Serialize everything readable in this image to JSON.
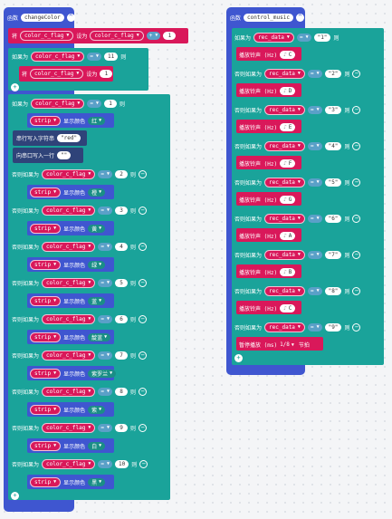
{
  "left_fn": {
    "head": "函数",
    "name": "changeColor"
  },
  "set_row": {
    "word": "将",
    "var": "color_c_flag",
    "mid": "设为",
    "var2": "color_c_flag",
    "op": "+",
    "num": "1"
  },
  "if1": {
    "kw": "如果为",
    "var": "color_c_flag",
    "eq": "=",
    "num": "11",
    "then": "则"
  },
  "set_in_if1": {
    "word": "将",
    "var": "color_c_flag",
    "mid": "设为",
    "num": "1"
  },
  "if2": {
    "kw": "如果为",
    "var": "color_c_flag",
    "eq": "=",
    "num": "1",
    "then": "则"
  },
  "strip_label": "strip",
  "show_color": "显示颜色",
  "c1": "红",
  "serial1": {
    "text": "串行写入字符串",
    "val": "\"red\""
  },
  "serial2": {
    "text": "向串口写入一行",
    "val": "\"\""
  },
  "else_if_label": "否则如果为",
  "branches": [
    {
      "num": "2",
      "color": "橙"
    },
    {
      "num": "3",
      "color": "黄"
    },
    {
      "num": "4",
      "color": "绿"
    },
    {
      "num": "5",
      "color": "蓝"
    },
    {
      "num": "6",
      "color": "靛蓝"
    },
    {
      "num": "7",
      "color": "紫罗兰"
    },
    {
      "num": "8",
      "color": "紫"
    },
    {
      "num": "9",
      "color": "白"
    },
    {
      "num": "10",
      "color": "黑"
    }
  ],
  "right_fn": {
    "head": "函数",
    "name": "control_music"
  },
  "music_var": "rec_data",
  "then": "则",
  "eq": "=",
  "play": "播放铃声 (Hz)",
  "music_first_kw": "如果为",
  "notes": [
    {
      "val": "\"1\"",
      "note": "C"
    },
    {
      "val": "\"2\"",
      "note": "D"
    },
    {
      "val": "\"3\"",
      "note": "E"
    },
    {
      "val": "\"4\"",
      "note": "F"
    },
    {
      "val": "\"5\"",
      "note": "G"
    },
    {
      "val": "\"6\"",
      "note": "A"
    },
    {
      "val": "\"7\"",
      "note": "B"
    },
    {
      "val": "\"8\"",
      "note": "C"
    },
    {
      "val": "\"9\"",
      "note": "休"
    }
  ],
  "rest": {
    "text": "暂停播放 (ms)",
    "beat": "1/8",
    "unit": "节拍"
  },
  "colors": {
    "fn": "#3f56d0",
    "logic": "#1aa39a",
    "var": "#d9185a",
    "serial": "#2f4379",
    "neo": "#3f56d0",
    "music": "#d9185a"
  },
  "icons": [
    "expand-icon",
    "plus-icon",
    "minus-icon",
    "dropdown-icon",
    "note-icon"
  ]
}
